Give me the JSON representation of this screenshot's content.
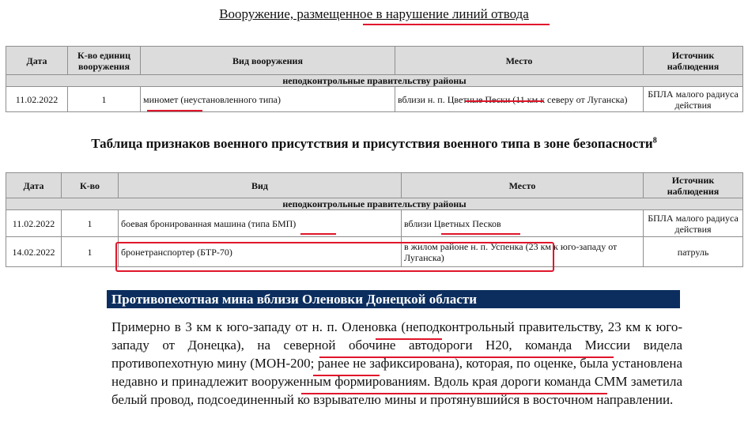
{
  "section_title": "Вооружение, размещенное в нарушение линий отвода",
  "table1": {
    "headers": [
      "Дата",
      "К-во единиц вооружения",
      "Вид вооружения",
      "Место",
      "Источник наблюдения"
    ],
    "subheader": "неподконтрольные правительству районы",
    "rows": [
      {
        "date": "11.02.2022",
        "count": "1",
        "type": "миномет (неустановленного типа)",
        "place": "вблизи н. п. Цветные Пески (11 км к северу от Луганска)",
        "source": "БПЛА малого радиуса действия"
      }
    ]
  },
  "table2_title": "Таблица признаков военного присутствия и присутствия военного типа в зоне безопасности",
  "table2_footnote": "8",
  "table2": {
    "headers": [
      "Дата",
      "К-во",
      "Вид",
      "Место",
      "Источник наблюдения"
    ],
    "subheader": "неподконтрольные правительству районы",
    "rows": [
      {
        "date": "11.02.2022",
        "count": "1",
        "type": "боевая бронированная машина (типа БМП)",
        "place": "вблизи Цветных Песков",
        "source": "БПЛА малого радиуса действия"
      },
      {
        "date": "14.02.2022",
        "count": "1",
        "type": "бронетранспортер (БТР-70)",
        "place": "в жилом районе н. п. Успенка (23 км к юго-западу от Луганска)",
        "source": "патруль"
      }
    ]
  },
  "mine_section": {
    "title": "Противопехотная мина вблизи Оленовки Донецкой области",
    "body": "Примерно в 3 км к юго-западу от н. п. Оленовка (неподконтрольный правительству, 23 км к юго-западу от Донецка), на северной обочине автодороги H20, команда Миссии видела противопехотную мину (МОН-200; ранее не зафиксирована), которая, по оценке, была установлена недавно и принадлежит вооруженным формированиям. Вдоль края дороги команда СММ заметила белый провод, подсоединенный ко взрывателю мины и протянувшийся в восточном направлении."
  },
  "colors": {
    "annotation": "#e0162b",
    "header_bg": "#dcdcdc",
    "section_bar": "#0b2e5e"
  }
}
